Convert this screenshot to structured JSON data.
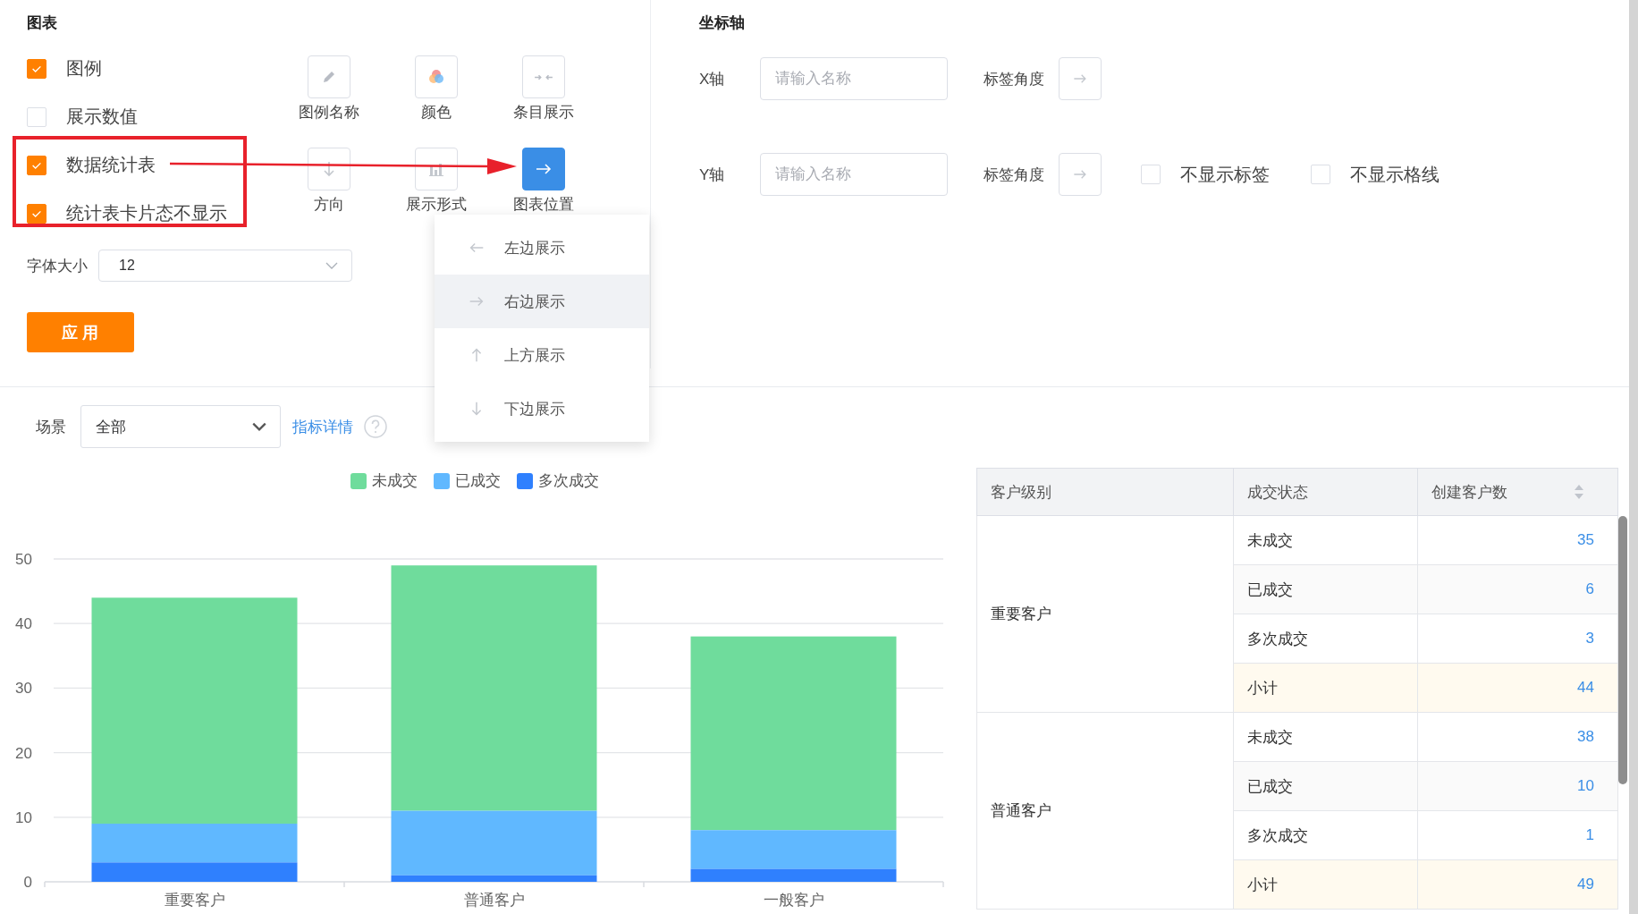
{
  "chart_settings": {
    "title": "图表",
    "options": [
      {
        "label": "图例",
        "checked": true
      },
      {
        "label": "展示数值",
        "checked": false
      },
      {
        "label": "数据统计表",
        "checked": true
      },
      {
        "label": "统计表卡片态不显示",
        "checked": true
      }
    ],
    "tools": [
      {
        "label": "图例名称",
        "kind": "pencil",
        "selected": false
      },
      {
        "label": "颜色",
        "kind": "colors",
        "selected": false
      },
      {
        "label": "条目展示",
        "kind": "collapse",
        "selected": false
      },
      {
        "label": "方向",
        "kind": "down",
        "selected": false
      },
      {
        "label": "展示形式",
        "kind": "bars",
        "selected": false
      },
      {
        "label": "图表位置",
        "kind": "right",
        "selected": true
      }
    ],
    "font_size": {
      "label": "字体大小",
      "value": "12"
    },
    "apply_button": "应 用"
  },
  "position_menu": {
    "items": [
      {
        "label": "左边展示",
        "kind": "left",
        "selected": false
      },
      {
        "label": "右边展示",
        "kind": "right",
        "selected": true
      },
      {
        "label": "上方展示",
        "kind": "up",
        "selected": false
      },
      {
        "label": "下边展示",
        "kind": "down",
        "selected": false
      }
    ]
  },
  "axis_settings": {
    "title": "坐标轴",
    "rows": [
      {
        "axis": "X轴",
        "placeholder": "请输入名称",
        "angle_label": "标签角度",
        "options": []
      },
      {
        "axis": "Y轴",
        "placeholder": "请输入名称",
        "angle_label": "标签角度",
        "options": [
          {
            "label": "不显示标签",
            "checked": false
          },
          {
            "label": "不显示格线",
            "checked": false
          }
        ]
      }
    ]
  },
  "filter": {
    "label": "场景",
    "value": "全部",
    "link": "指标详情"
  },
  "chart": {
    "chart_data": {
      "type": "bar",
      "stacked": true,
      "grid": true,
      "categories": [
        "重要客户",
        "普通客户",
        "一般客户"
      ],
      "ylim": [
        0,
        50
      ],
      "yticks": [
        0,
        10,
        20,
        30,
        40,
        50
      ],
      "series": [
        {
          "name": "未成交",
          "color": "#6fdc9c",
          "values": [
            35,
            38,
            30
          ]
        },
        {
          "name": "已成交",
          "color": "#60b8ff",
          "values": [
            6,
            10,
            6
          ]
        },
        {
          "name": "多次成交",
          "color": "#2f80fe",
          "values": [
            3,
            1,
            2
          ]
        }
      ]
    }
  },
  "table": {
    "columns": [
      "客户级别",
      "成交状态",
      "创建客户数"
    ],
    "groups": [
      {
        "level": "重要客户",
        "rows": [
          {
            "status": "未成交",
            "count": "35",
            "kind": "item"
          },
          {
            "status": "已成交",
            "count": "6",
            "kind": "item"
          },
          {
            "status": "多次成交",
            "count": "3",
            "kind": "item"
          },
          {
            "status": "小计",
            "count": "44",
            "kind": "subtotal"
          }
        ]
      },
      {
        "level": "普通客户",
        "rows": [
          {
            "status": "未成交",
            "count": "38",
            "kind": "item"
          },
          {
            "status": "已成交",
            "count": "10",
            "kind": "item"
          },
          {
            "status": "多次成交",
            "count": "1",
            "kind": "item"
          },
          {
            "status": "小计",
            "count": "49",
            "kind": "subtotal"
          }
        ]
      }
    ]
  }
}
